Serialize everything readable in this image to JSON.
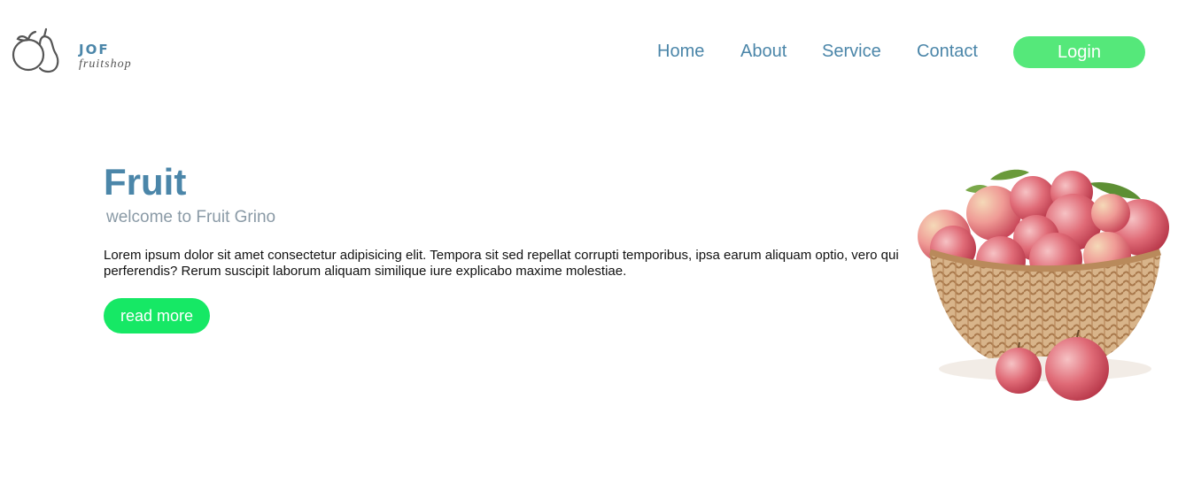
{
  "brand": {
    "name": "JOF",
    "tagline": "fruitshop"
  },
  "nav": {
    "items": [
      {
        "label": "Home"
      },
      {
        "label": "About"
      },
      {
        "label": "Service"
      },
      {
        "label": "Contact"
      }
    ],
    "login_label": "Login"
  },
  "hero": {
    "title": "Fruit",
    "subtitle": "welcome to Fruit Grino",
    "body": "Lorem ipsum dolor sit amet consectetur adipisicing elit. Tempora sit sed repellat corrupti temporibus, ipsa earum aliquam optio, vero qui perferendis? Rerum suscipit laborum aliquam similique iure explicabo maxime molestiae.",
    "button_label": "read more"
  },
  "colors": {
    "brand_blue": "#4b86a9",
    "login_green": "#55e87a",
    "cta_green": "#16e865",
    "subtitle_gray": "#8a9aa6"
  },
  "icons": {
    "logo": "apple-pear-icon",
    "image": "apple-basket-image"
  }
}
